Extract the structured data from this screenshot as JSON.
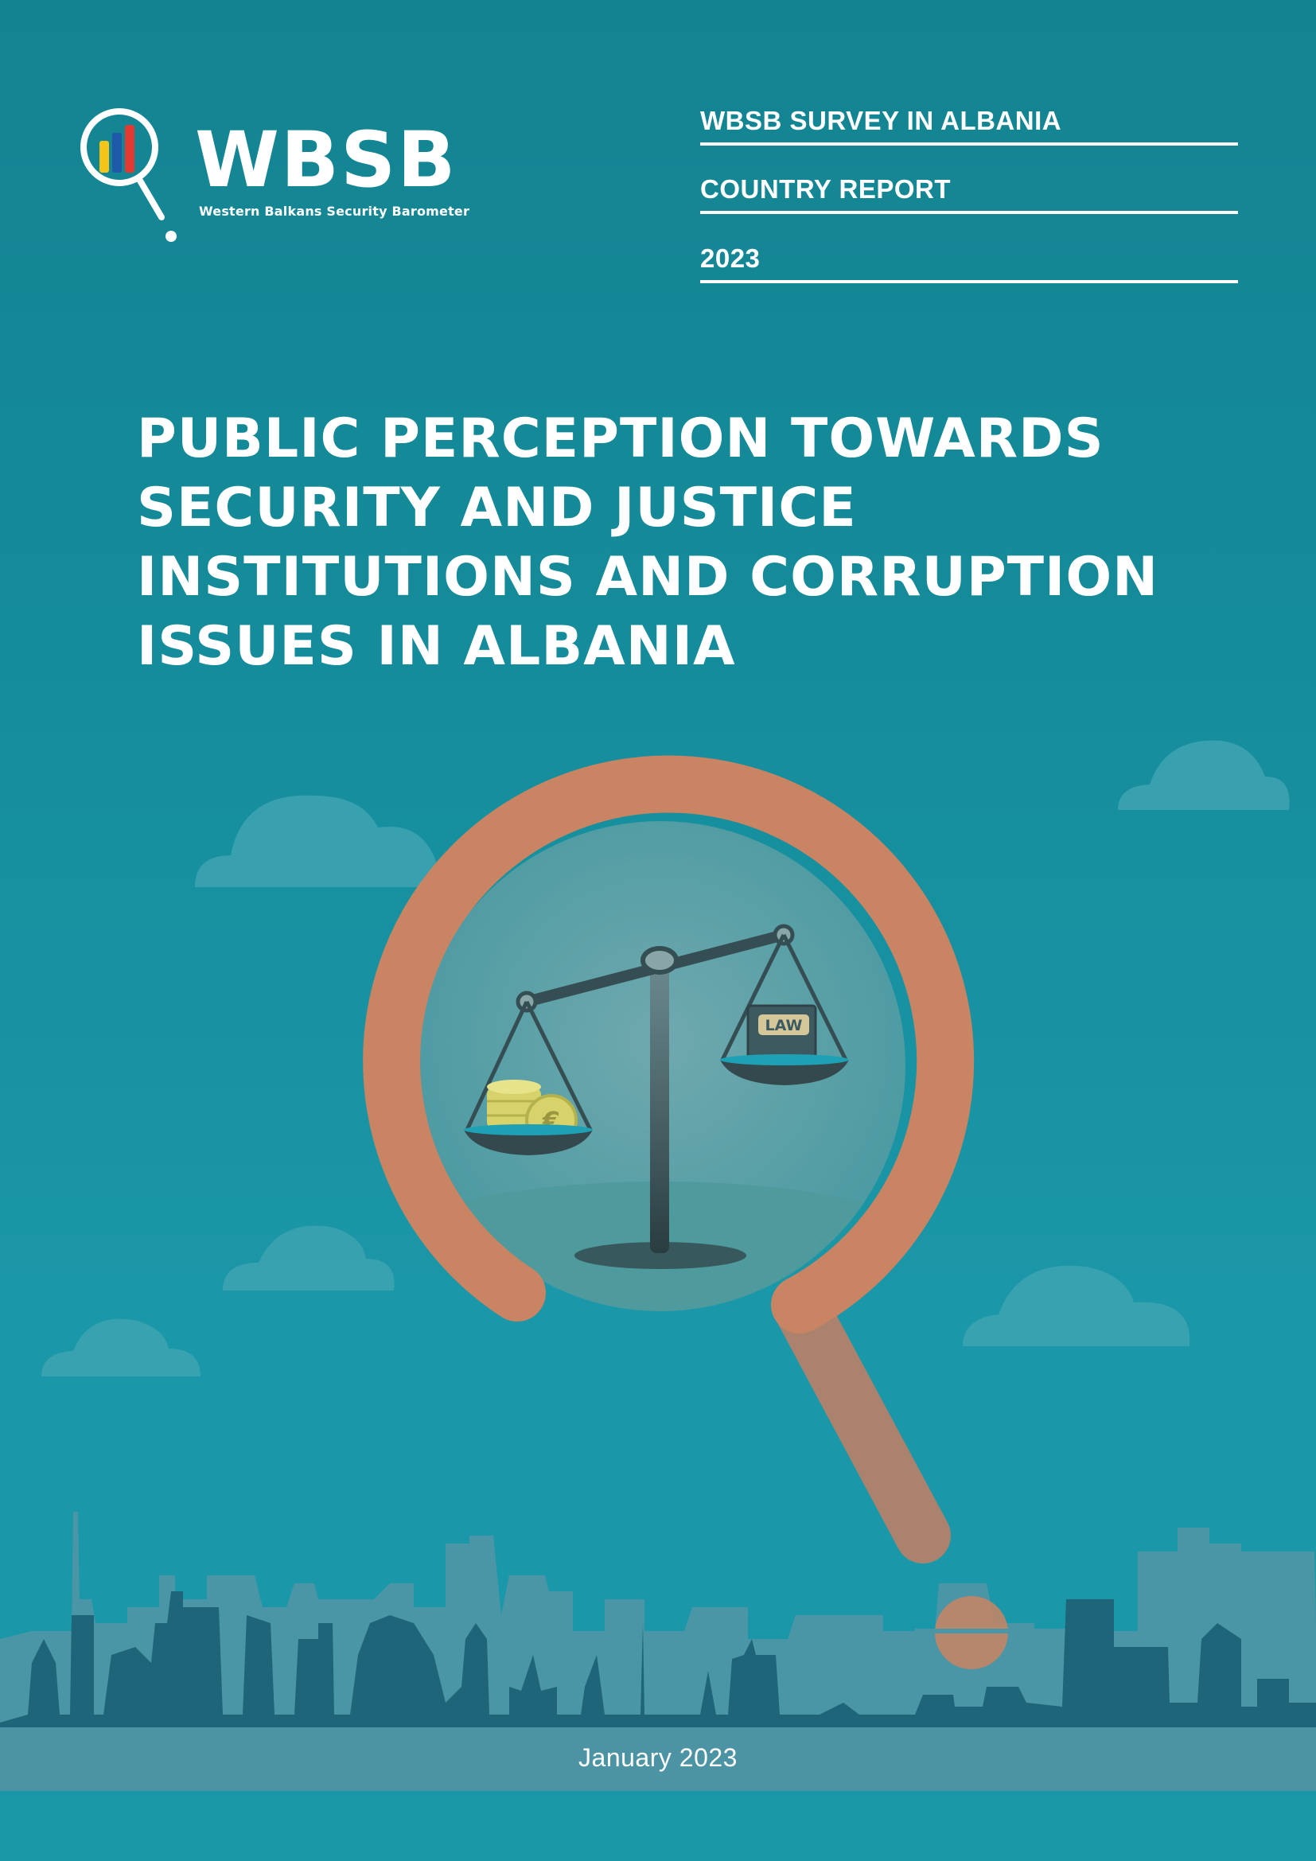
{
  "brand": {
    "name": "WBSB",
    "tagline": "Western Balkans Security Barometer",
    "bar_colors": [
      "#f2c518",
      "#1e58a8",
      "#e23a31"
    ]
  },
  "meta": {
    "survey": "WBSB SURVEY IN ALBANIA",
    "report_type": "COUNTRY REPORT",
    "year": "2023"
  },
  "title_lines": [
    "PUBLIC PERCEPTION TOWARDS",
    "SECURITY AND JUSTICE",
    "INSTITUTIONS AND CORRUPTION",
    "ISSUES IN ALBANIA"
  ],
  "illustration": {
    "book_label": "LAW",
    "coin_symbol": "€",
    "icons": [
      "magnifier-icon",
      "scales-of-justice-icon",
      "coin-stack-icon",
      "law-book-icon",
      "city-skyline"
    ]
  },
  "footer": {
    "date": "January 2023"
  },
  "colors": {
    "background": "#158c9b",
    "magnifier": "#c98463",
    "skyline_front": "#1e6579",
    "skyline_back": "#4a96a6",
    "coins": "#d7d36a"
  }
}
